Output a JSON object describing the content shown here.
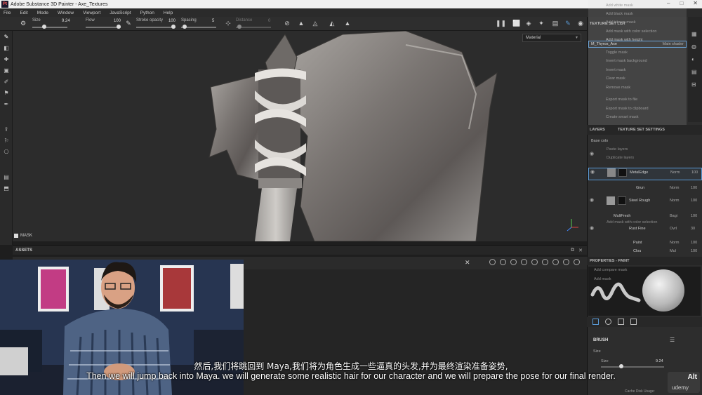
{
  "window": {
    "title": "Adobe Substance 3D Painter - Axe_Textures",
    "logo": "Pt"
  },
  "menu": [
    "File",
    "Edit",
    "Mode",
    "Window",
    "Viewport",
    "JavaScript",
    "Python",
    "Help"
  ],
  "toolbar": {
    "size_label": "Size",
    "size_value": "9.24",
    "flow_label": "Flow",
    "flow_value": "100",
    "stroke_opacity_label": "Stroke opacity",
    "stroke_opacity_value": "100",
    "spacing_label": "Spacing",
    "spacing_value": "5",
    "distance_label": "Distance",
    "distance_value": "0"
  },
  "viewport": {
    "display_mode": "Material",
    "mask_label": "MASK"
  },
  "assets": {
    "title": "ASSETS"
  },
  "context_menu": {
    "items": [
      "Add white mask",
      "Add black mask",
      "Add bitmap mask",
      "Add mask with color selection",
      "Add mask with height",
      "Toggle mask",
      "Invert mask background",
      "Invert mask",
      "Clear mask",
      "Remove mask",
      "Export mask to file",
      "Export mask to clipboard",
      "Create smart mask"
    ]
  },
  "texture_set": {
    "title": "TEXTURE SET LIST",
    "name": "M_Thyros_Axe",
    "shader": "Main shader"
  },
  "layers": {
    "tab_layers": "LAYERS",
    "tab_tss": "TEXTURE SET SETTINGS",
    "base_color": "Base colo",
    "items": [
      {
        "name": "MetalEdge",
        "blend": "Norm",
        "opacity": "100"
      },
      {
        "name": "Grun",
        "blend": "Norm",
        "opacity": "100"
      },
      {
        "name": "Steel Rough",
        "blend": "Norm",
        "opacity": "100"
      },
      {
        "name": "MultFresh",
        "blend": "Bagi",
        "opacity": "100"
      },
      {
        "name": "Rust Fine",
        "blend": "Ovrl",
        "opacity": "30"
      },
      {
        "name": "Paint",
        "blend": "Norm",
        "opacity": "100"
      },
      {
        "name": "Clou",
        "blend": "Mul",
        "opacity": "100"
      }
    ],
    "ghost_items": [
      "Paste layers",
      "Duplicate layers",
      "Add mask with color selection",
      "Add compare mask",
      "Add mask"
    ]
  },
  "properties": {
    "title": "PROPERTIES - PAINT",
    "brush_section": "BRUSH",
    "size_label": "Size",
    "size_sub_label": "Size",
    "size_value": "9.24",
    "cache": "Cache Disk Usage:"
  },
  "subtitles": {
    "chinese": "然后,我们将跳回到 Maya,我们将为角色生成一些逼真的头发,并为最终渲染准备姿势,",
    "english": "Then we will jump back into Maya. we will generate some realistic hair for our character and we will prepare the pose for our final render."
  },
  "watermark": {
    "alt": "Alt",
    "brand": "udemy"
  }
}
